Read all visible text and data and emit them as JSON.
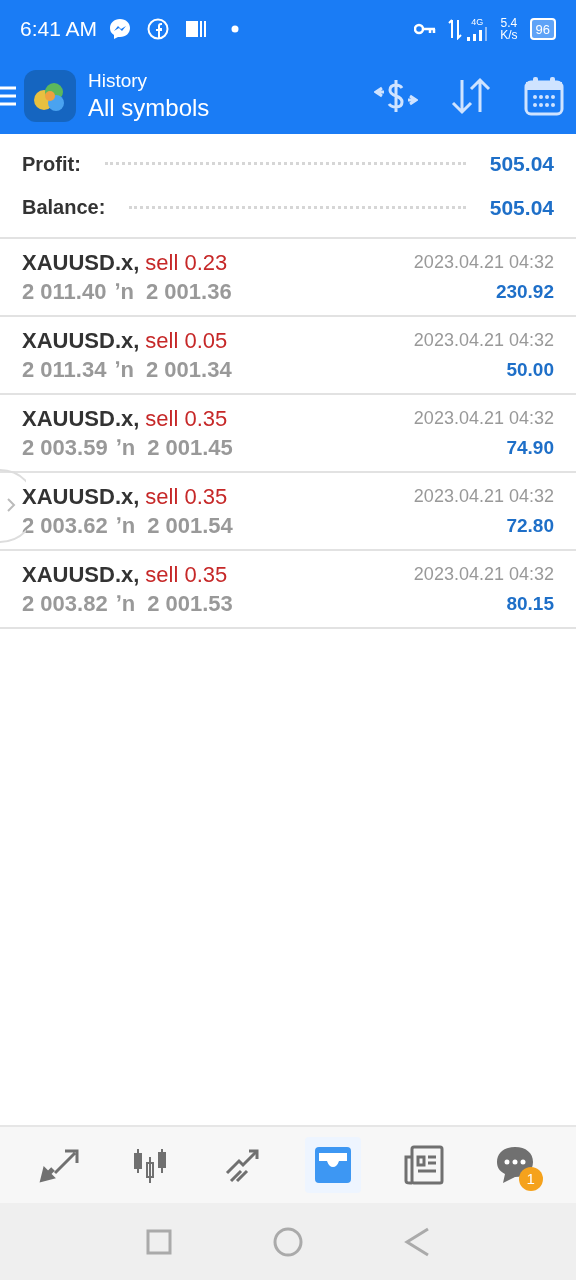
{
  "status_bar": {
    "time": "6:41 AM",
    "network": "4G",
    "speed_value": "5.4",
    "speed_unit": "K/s",
    "battery": "96"
  },
  "header": {
    "title": "History",
    "subtitle": "All symbols"
  },
  "summary": [
    {
      "label": "Profit:",
      "value": "505.04"
    },
    {
      "label": "Balance:",
      "value": "505.04"
    }
  ],
  "deals": [
    {
      "symbol": "XAUUSD.x,",
      "side": "sell 0.23",
      "open": "2 011.40",
      "arrow": "ʼn",
      "close": "2 001.36",
      "time": "2023.04.21 04:32",
      "profit": "230.92"
    },
    {
      "symbol": "XAUUSD.x,",
      "side": "sell 0.05",
      "open": "2 011.34",
      "arrow": "ʼn",
      "close": "2 001.34",
      "time": "2023.04.21 04:32",
      "profit": "50.00"
    },
    {
      "symbol": "XAUUSD.x,",
      "side": "sell 0.35",
      "open": "2 003.59",
      "arrow": "ʼn",
      "close": "2 001.45",
      "time": "2023.04.21 04:32",
      "profit": "74.90"
    },
    {
      "symbol": "XAUUSD.x,",
      "side": "sell 0.35",
      "open": "2 003.62",
      "arrow": "ʼn",
      "close": "2 001.54",
      "time": "2023.04.21 04:32",
      "profit": "72.80"
    },
    {
      "symbol": "XAUUSD.x,",
      "side": "sell 0.35",
      "open": "2 003.82",
      "arrow": "ʼn",
      "close": "2 001.53",
      "time": "2023.04.21 04:32",
      "profit": "80.15"
    }
  ],
  "bottom_nav": [
    {
      "kind": "quotes",
      "selected": false
    },
    {
      "kind": "chart",
      "selected": false
    },
    {
      "kind": "trade",
      "selected": false
    },
    {
      "kind": "history",
      "selected": true
    },
    {
      "kind": "news",
      "selected": false
    },
    {
      "kind": "messages",
      "selected": false,
      "badge": "1"
    }
  ]
}
